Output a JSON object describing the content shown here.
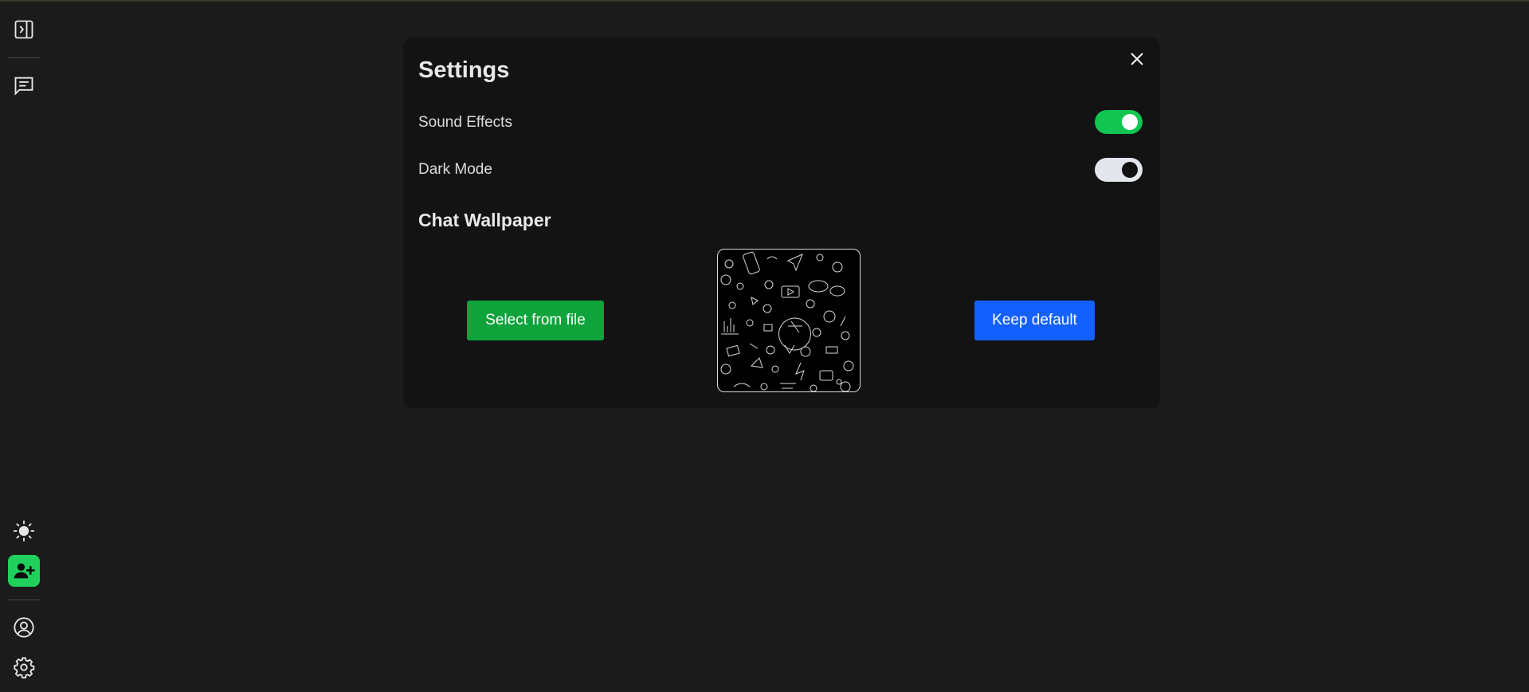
{
  "sidebar": {
    "top_items": [
      {
        "icon": "panel-expand-icon"
      },
      {
        "icon": "chat-icon"
      }
    ],
    "bottom_items": [
      {
        "icon": "sun-icon"
      },
      {
        "icon": "add-user-icon"
      },
      {
        "icon": "profile-icon"
      },
      {
        "icon": "gear-icon"
      }
    ],
    "accent_color": "#1fd15c"
  },
  "settings": {
    "title": "Settings",
    "close_icon": "close-icon",
    "sound_effects": {
      "label": "Sound Effects",
      "enabled": true,
      "color": "#12c451"
    },
    "dark_mode": {
      "label": "Dark Mode",
      "enabled": true
    },
    "wallpaper": {
      "title": "Chat Wallpaper",
      "select_label": "Select from file",
      "select_color": "#0ea33b",
      "default_label": "Keep default",
      "default_color": "#1460ff"
    }
  }
}
